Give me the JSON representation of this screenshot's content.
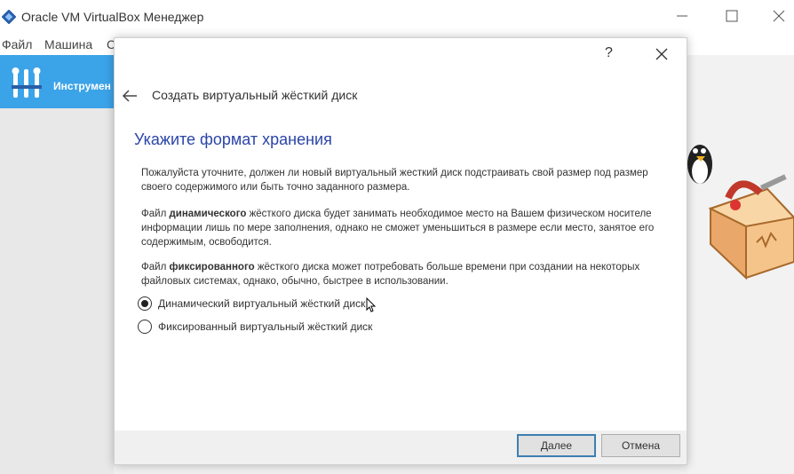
{
  "main_window": {
    "title": "Oracle VM VirtualBox Менеджер",
    "menu": [
      "Файл",
      "Машина",
      "С"
    ],
    "tools_label": "Инструмен"
  },
  "dialog": {
    "help_label": "?",
    "wizard_title": "Создать виртуальный жёсткий диск",
    "heading": "Укажите формат хранения",
    "paragraph1": "Пожалуйста уточните, должен ли новый виртуальный жесткий диск подстраивать свой размер под размер своего содержимого или быть точно заданного размера.",
    "paragraph2": {
      "prefix": "Файл ",
      "bold": "динамического",
      "rest": " жёсткого диска будет занимать необходимое место на Вашем физическом носителе информации лишь по мере заполнения, однако не сможет уменьшиться в размере если место, занятое его содержимым, освободится."
    },
    "paragraph3": {
      "prefix": "Файл ",
      "bold": "фиксированного",
      "rest": " жёсткого диска может потребовать больше времени при создании на некоторых файловых системах, однако, обычно, быстрее в использовании."
    },
    "options": [
      {
        "label": "Динамический виртуальный жёсткий диск",
        "selected": true
      },
      {
        "label": "Фиксированный виртуальный жёсткий диск",
        "selected": false
      }
    ],
    "buttons": {
      "next": "Далее",
      "cancel": "Отмена"
    }
  },
  "icons": [
    "virtualbox-logo-icon",
    "minimize-icon",
    "maximize-icon",
    "close-icon",
    "tools-icon",
    "back-arrow-icon",
    "mouse-cursor-icon",
    "linux-mascot-icon"
  ],
  "colors": {
    "accent_blue": "#3ba3e8",
    "heading_blue": "#2b45a8",
    "default_button_border": "#3c7fb1"
  }
}
